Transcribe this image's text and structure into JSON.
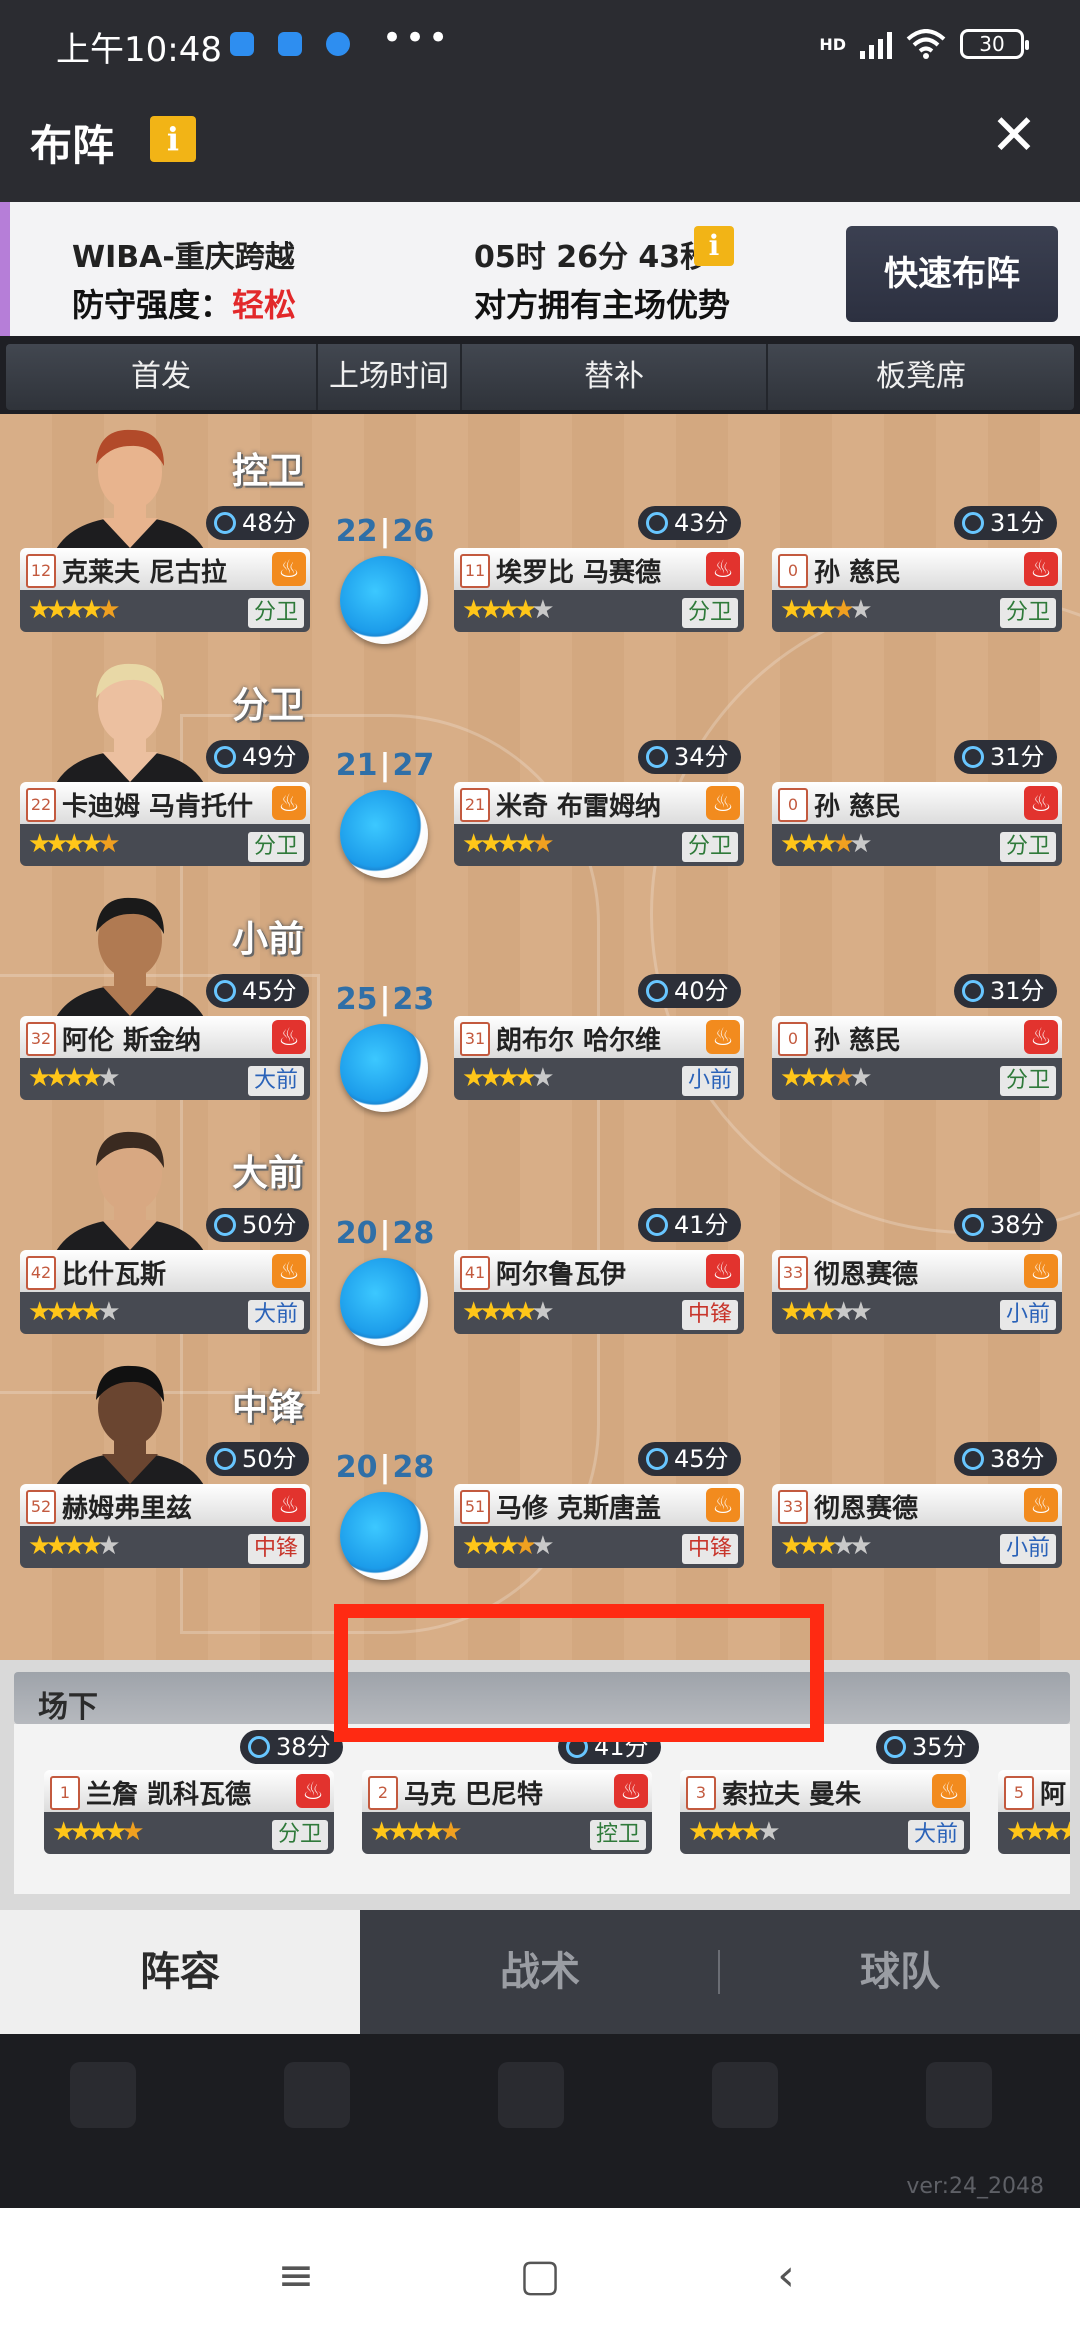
{
  "status_bar": {
    "time": "上午10:48",
    "dots": "•••",
    "network": "HD",
    "battery": "30"
  },
  "title_bar": {
    "title": "布阵",
    "info": "i",
    "close": "✕"
  },
  "match": {
    "team": "WIBA-重庆跨越",
    "defense_label": "防守强度：",
    "defense_value": "轻松",
    "timer": "05时 26分 43秒",
    "home_note": "对方拥有主场优势",
    "quick_button": "快速布阵"
  },
  "columns": [
    "首发",
    "上场时间",
    "替补",
    "板凳席"
  ],
  "rows": [
    {
      "position": "控卫",
      "split_a": "22",
      "split_b": "26",
      "starter": {
        "minutes": "48分",
        "num": "12",
        "name": "克莱夫 尼古拉",
        "fire": "orange",
        "stars": 4.5,
        "pos": "分卫",
        "pos_color": "green"
      },
      "sub": {
        "minutes": "43分",
        "num": "11",
        "name": "埃罗比 马赛德",
        "fire": "red",
        "stars": 4,
        "pos": "分卫",
        "pos_color": "green"
      },
      "bench": {
        "minutes": "31分",
        "num": "0",
        "name": "孙 慈民",
        "fire": "red",
        "stars": 3.5,
        "pos": "分卫",
        "pos_color": "green"
      }
    },
    {
      "position": "分卫",
      "split_a": "21",
      "split_b": "27",
      "starter": {
        "minutes": "49分",
        "num": "22",
        "name": "卡迪姆 马肯托什",
        "fire": "orange",
        "stars": 4.5,
        "pos": "分卫",
        "pos_color": "green"
      },
      "sub": {
        "minutes": "34分",
        "num": "21",
        "name": "米奇 布雷姆纳",
        "fire": "orange",
        "stars": 4.5,
        "pos": "分卫",
        "pos_color": "green"
      },
      "bench": {
        "minutes": "31分",
        "num": "0",
        "name": "孙 慈民",
        "fire": "red",
        "stars": 3.5,
        "pos": "分卫",
        "pos_color": "green"
      }
    },
    {
      "position": "小前",
      "split_a": "25",
      "split_b": "23",
      "starter": {
        "minutes": "45分",
        "num": "32",
        "name": "阿伦 斯金纳",
        "fire": "red",
        "stars": 4,
        "pos": "大前",
        "pos_color": "blue"
      },
      "sub": {
        "minutes": "40分",
        "num": "31",
        "name": "朗布尔 哈尔维",
        "fire": "orange",
        "stars": 4,
        "pos": "小前",
        "pos_color": "blue"
      },
      "bench": {
        "minutes": "31分",
        "num": "0",
        "name": "孙 慈民",
        "fire": "red",
        "stars": 3.5,
        "pos": "分卫",
        "pos_color": "green"
      }
    },
    {
      "position": "大前",
      "split_a": "20",
      "split_b": "28",
      "starter": {
        "minutes": "50分",
        "num": "42",
        "name": "比什瓦斯",
        "fire": "orange",
        "stars": 4,
        "pos": "大前",
        "pos_color": "blue"
      },
      "sub": {
        "minutes": "41分",
        "num": "41",
        "name": "阿尔鲁瓦伊",
        "fire": "red",
        "stars": 4,
        "pos": "中锋",
        "pos_color": "red"
      },
      "bench": {
        "minutes": "38分",
        "num": "33",
        "name": "彻恩赛德",
        "fire": "orange",
        "stars": 3,
        "pos": "小前",
        "pos_color": "blue"
      }
    },
    {
      "position": "中锋",
      "split_a": "20",
      "split_b": "28",
      "starter": {
        "minutes": "50分",
        "num": "52",
        "name": "赫姆弗里兹",
        "fire": "red",
        "stars": 4,
        "pos": "中锋",
        "pos_color": "red"
      },
      "sub": {
        "minutes": "45分",
        "num": "51",
        "name": "马修 克斯唐盖",
        "fire": "orange",
        "stars": 3.5,
        "pos": "中锋",
        "pos_color": "red"
      },
      "bench": {
        "minutes": "38分",
        "num": "33",
        "name": "彻恩赛德",
        "fire": "orange",
        "stars": 3,
        "pos": "小前",
        "pos_color": "blue"
      }
    }
  ],
  "bench": {
    "title": "场下",
    "players": [
      {
        "minutes": "38分",
        "num": "1",
        "name": "兰詹 凯科瓦德",
        "fire": "red",
        "stars": 4.5,
        "pos": "分卫",
        "pos_color": "green"
      },
      {
        "minutes": "41分",
        "num": "2",
        "name": "马克 巴尼特",
        "fire": "red",
        "stars": 4.5,
        "pos": "控卫",
        "pos_color": "green"
      },
      {
        "minutes": "35分",
        "num": "3",
        "name": "索拉夫 曼朱",
        "fire": "orange",
        "stars": 4,
        "pos": "大前",
        "pos_color": "blue"
      },
      {
        "minutes": "",
        "num": "5",
        "name": "阿",
        "fire": "orange",
        "stars": 4,
        "pos": "",
        "pos_color": "blue"
      }
    ]
  },
  "tabs": [
    {
      "label": "阵容",
      "active": true
    },
    {
      "label": "战术",
      "active": false
    },
    {
      "label": "球队",
      "active": false
    }
  ],
  "version": "ver:24_2048",
  "colors": {
    "fire_orange": "#f28b1e",
    "fire_red": "#e2332e",
    "pos_green": "#2f7a3a",
    "pos_blue": "#2a62b8",
    "pos_red": "#c8352b",
    "highlight": "#ff2a12"
  },
  "icons": {
    "close": "close-icon",
    "info": "info-icon",
    "clock": "clock-icon",
    "fire": "fire-icon",
    "star": "star-icon",
    "nav_menu": "menu-icon",
    "nav_home": "home-icon",
    "nav_back": "back-icon"
  }
}
